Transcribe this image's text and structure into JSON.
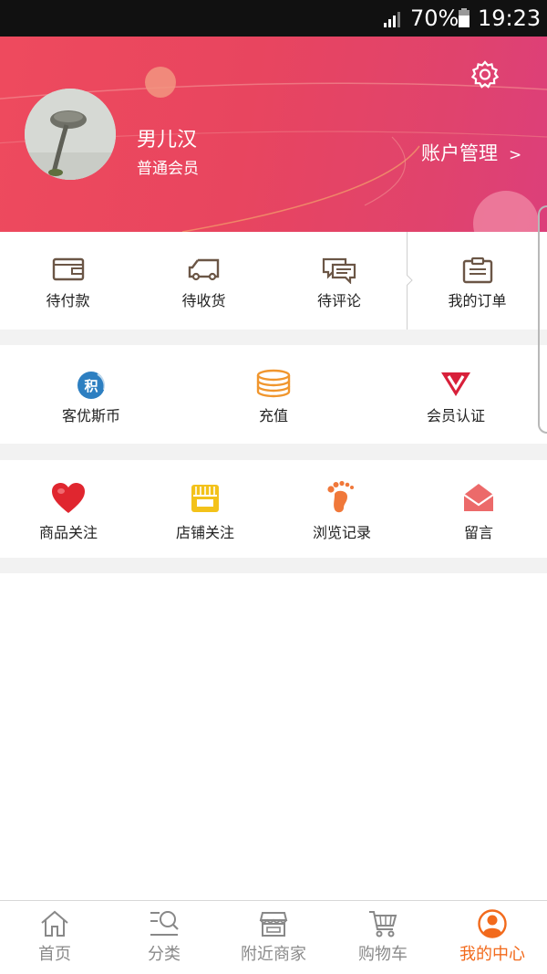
{
  "status_bar": {
    "battery_percent": "70%",
    "time": "19:23"
  },
  "profile": {
    "username": "男儿汉",
    "member_level": "普通会员",
    "account_management": "账户管理",
    "chevron": ">"
  },
  "orders": [
    {
      "label": "待付款",
      "icon": "wallet-icon"
    },
    {
      "label": "待收货",
      "icon": "truck-icon"
    },
    {
      "label": "待评论",
      "icon": "comment-icon"
    },
    {
      "label": "我的订单",
      "icon": "clipboard-icon"
    }
  ],
  "wallet": [
    {
      "label": "客优斯币",
      "icon": "points-icon",
      "icon_text": "积"
    },
    {
      "label": "充值",
      "icon": "coins-icon"
    },
    {
      "label": "会员认证",
      "icon": "vip-icon"
    }
  ],
  "favorites": [
    {
      "label": "商品关注",
      "icon": "heart-icon"
    },
    {
      "label": "店铺关注",
      "icon": "shop-icon"
    },
    {
      "label": "浏览记录",
      "icon": "footprint-icon"
    },
    {
      "label": "留言",
      "icon": "envelope-icon"
    }
  ],
  "tabs": [
    {
      "label": "首页",
      "icon": "home-icon"
    },
    {
      "label": "分类",
      "icon": "category-search-icon"
    },
    {
      "label": "附近商家",
      "icon": "store-icon"
    },
    {
      "label": "购物车",
      "icon": "cart-icon"
    },
    {
      "label": "我的中心",
      "icon": "user-icon",
      "active": true
    }
  ],
  "colors": {
    "header": "#e8455f",
    "accent": "#f26a1c",
    "icon_brown": "#6b5646",
    "vip_red": "#d8203a",
    "coin_orange": "#f0962e",
    "points_blue": "#2d7fc1",
    "shop_yellow": "#f3c21a",
    "envelope_red": "#ec6a6a"
  }
}
